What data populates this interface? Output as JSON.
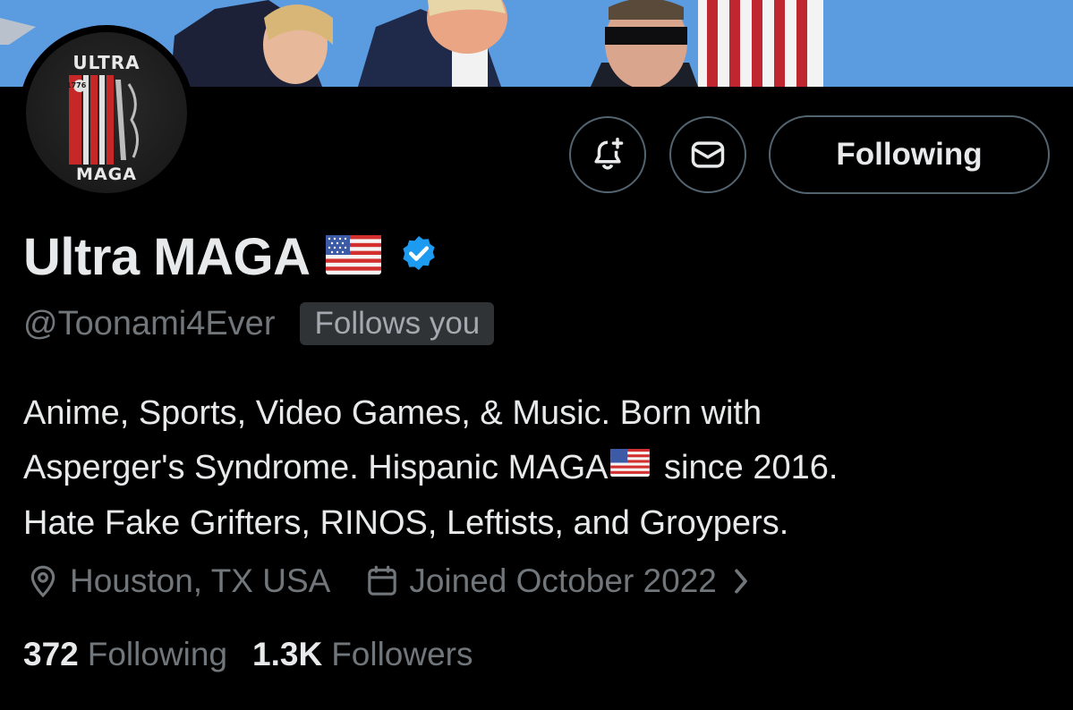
{
  "avatar": {
    "top_text": "ULTRA",
    "bottom_text": "MAGA",
    "year": "1776"
  },
  "actions": {
    "notify_icon": "bell-plus-icon",
    "message_icon": "envelope-icon",
    "follow_label": "Following"
  },
  "profile": {
    "display_name": "Ultra MAGA",
    "name_emoji": "us-flag-icon",
    "verified_icon": "verified-badge-icon",
    "verified_color": "#1d9bf0",
    "handle": "@Toonami4Ever",
    "follows_you": "Follows you"
  },
  "bio": {
    "line1": "Anime, Sports, Video Games, & Music. Born with",
    "line2a": "Asperger's Syndrome. Hispanic MAGA",
    "line2b": " since 2016.",
    "line3": "Hate Fake Grifters, RINOS, Leftists, and Groypers."
  },
  "meta": {
    "location_icon": "location-pin-icon",
    "location": "Houston, TX USA",
    "joined_icon": "calendar-icon",
    "joined": "Joined October 2022"
  },
  "stats": {
    "following_count": "372",
    "following_label": "Following",
    "followers_count": "1.3K",
    "followers_label": "Followers"
  },
  "colors": {
    "background": "#000000",
    "primary_text": "#e7e9ea",
    "secondary_text": "#71767b",
    "border": "#536471",
    "badge_bg": "#2f3336"
  }
}
